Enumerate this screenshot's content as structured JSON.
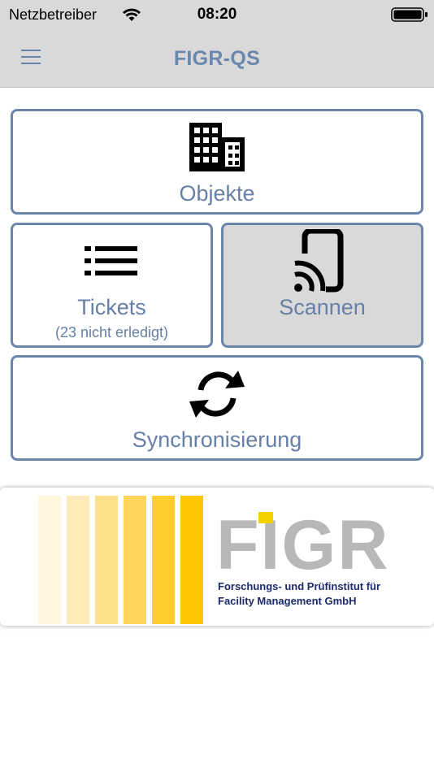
{
  "status_bar": {
    "carrier": "Netzbetreiber",
    "time": "08:20"
  },
  "nav": {
    "title": "FIGR-QS"
  },
  "tiles": {
    "objekte": {
      "label": "Objekte",
      "icon": "building-icon"
    },
    "tickets": {
      "label": "Tickets",
      "sublabel": "(23 nicht erledigt)",
      "icon": "list-icon"
    },
    "scannen": {
      "label": "Scannen",
      "icon": "nfc-phone-icon"
    },
    "sync": {
      "label": "Synchronisierung",
      "icon": "sync-icon"
    }
  },
  "logo": {
    "name": "FIGR",
    "line1": "Forschungs- und Prüfinstitut für",
    "line2": "Facility Management GmbH",
    "stripe_colors": [
      "#fff6e0",
      "#ffeab8",
      "#ffe08a",
      "#ffd65a",
      "#ffcd2e",
      "#ffc800"
    ]
  },
  "colors": {
    "accent": "#6a87ad",
    "bar_bg": "#d9d9d9"
  }
}
